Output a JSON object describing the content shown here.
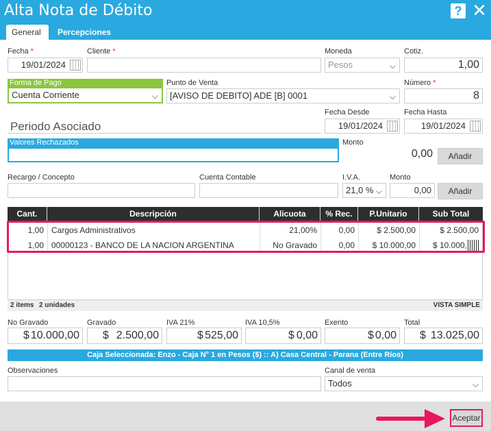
{
  "window": {
    "title": "Alta Nota de Débito"
  },
  "tabs": [
    {
      "label": "General"
    },
    {
      "label": "Percepciones"
    }
  ],
  "form": {
    "fecha": {
      "label": "Fecha",
      "value": "19/01/2024"
    },
    "cliente": {
      "label": "Cliente",
      "value": ""
    },
    "moneda": {
      "label": "Moneda",
      "value": "Pesos"
    },
    "cotiz": {
      "label": "Cotiz.",
      "value": "1,00"
    },
    "forma_pago": {
      "label": "Forma de Pago",
      "value": "Cuenta Corriente"
    },
    "punto_venta": {
      "label": "Punto de Venta",
      "value": "[AVISO DE DEBITO] ADE [B] 0001"
    },
    "numero": {
      "label": "Número",
      "value": "8"
    },
    "periodo": {
      "label": "Periodo Asociado"
    },
    "fecha_desde": {
      "label": "Fecha Desde",
      "value": "19/01/2024"
    },
    "fecha_hasta": {
      "label": "Fecha Hasta",
      "value": "19/01/2024"
    },
    "valores_rechazados": {
      "label": "Valores Rechazados",
      "value": ""
    },
    "monto1": {
      "label": "Monto",
      "value": "0,00"
    },
    "anadir_label": "Añadir",
    "recargo": {
      "label": "Recargo / Concepto",
      "value": ""
    },
    "cuenta_contable": {
      "label": "Cuenta Contable",
      "value": ""
    },
    "iva": {
      "label": "I.V.A.",
      "value": "21,0 %"
    },
    "monto2": {
      "label": "Monto",
      "value": "0,00"
    }
  },
  "grid": {
    "headers": [
      "Cant.",
      "Descripción",
      "Alicuota",
      "% Rec.",
      "P.Unitario",
      "Sub Total"
    ],
    "rows": [
      [
        "1,00",
        "Cargos Administrativos",
        "21,00%",
        "0,00",
        "$ 2.500,00",
        "$ 2.500,00"
      ],
      [
        "1,00",
        "00000123 - BANCO DE LA NACION ARGENTINA",
        "No Gravado",
        "0,00",
        "$ 10.000,00",
        "$ 10.000,"
      ]
    ],
    "footer_items": "2 items",
    "footer_units": "2 unidades",
    "view_mode": "VISTA SIMPLE"
  },
  "totals": [
    {
      "label": "No Gravado",
      "currency": "$",
      "value": "10.000,00"
    },
    {
      "label": "Gravado",
      "currency": "$",
      "value": "2.500,00"
    },
    {
      "label": "IVA 21%",
      "currency": "$",
      "value": "525,00"
    },
    {
      "label": "IVA 10,5%",
      "currency": "$",
      "value": "0,00"
    },
    {
      "label": "Exento",
      "currency": "$",
      "value": "0,00"
    },
    {
      "label": "Total",
      "currency": "$",
      "value": "13.025,00"
    }
  ],
  "caja": "Caja Seleccionada: Enzo - Caja N° 1 en Pesos ($) :: A) Casa Central - Parana (Entre Ríos)",
  "observaciones": {
    "label": "Observaciones",
    "value": ""
  },
  "canal_venta": {
    "label": "Canal de venta",
    "value": "Todos"
  },
  "accept_label": "Aceptar",
  "colors": {
    "accent": "#29a9e0",
    "highlight": "#e8175d",
    "green_border": "#8cc63f",
    "header_dark": "#2e2e2e"
  }
}
